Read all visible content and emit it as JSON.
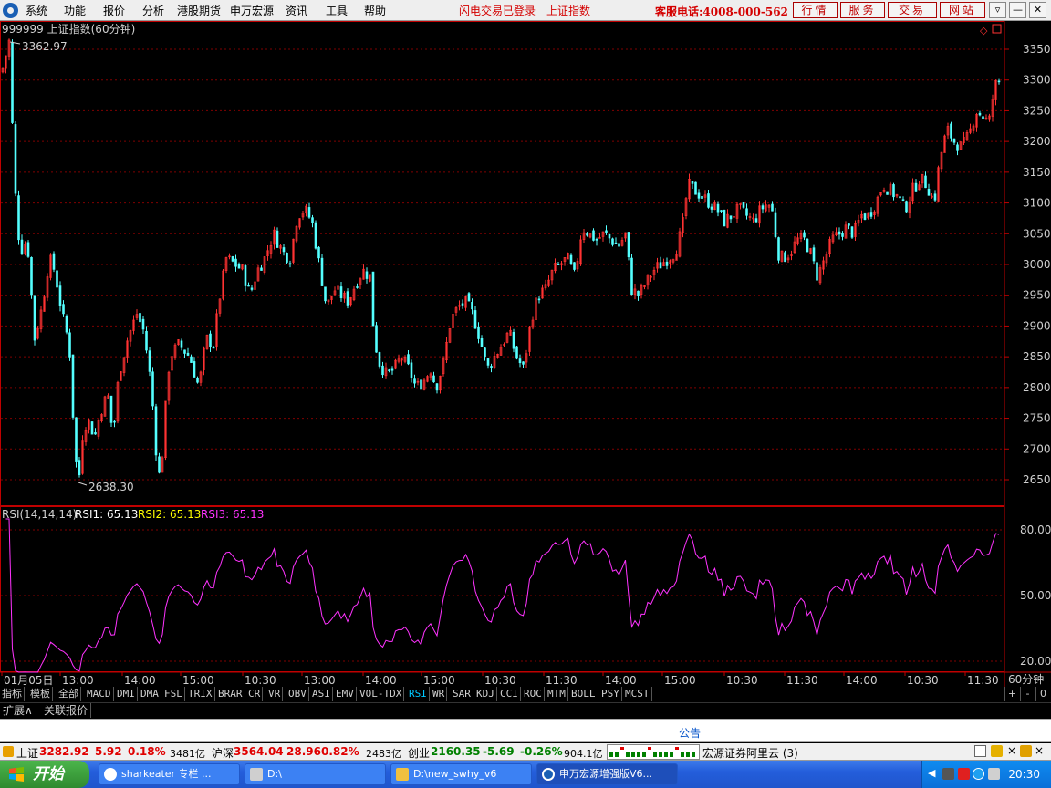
{
  "menu": {
    "items": [
      "系统",
      "功能",
      "报价",
      "分析",
      "港股期货",
      "申万宏源",
      "资讯",
      "工具",
      "帮助"
    ],
    "status_login": "闪电交易已登录",
    "status_index": "上证指数",
    "hotline": "客服电话:4008-000-562",
    "buttons": [
      "行情",
      "服务",
      "交易",
      "网站"
    ]
  },
  "chart": {
    "title": "999999 上证指数(60分钟)",
    "high_label": "3362.97",
    "low_label": "2638.30",
    "price_ticks": [
      "3350",
      "3300",
      "3250",
      "3200",
      "3150",
      "3100",
      "3050",
      "3000",
      "2950",
      "2900",
      "2850",
      "2800",
      "2750",
      "2700",
      "2650"
    ],
    "rsi_header": "RSI(14,14,14)",
    "rsi1_label": "RSI1: 65.13",
    "rsi2_label": "RSI2: 65.13",
    "rsi3_label": "RSI3: 65.13",
    "rsi_ticks": [
      "80.00",
      "50.00",
      "20.00"
    ],
    "time_labels": [
      "01月05日",
      "13:00",
      "14:00",
      "15:00",
      "10:30",
      "13:00",
      "14:00",
      "15:00",
      "10:30",
      "11:30",
      "14:00",
      "15:00",
      "10:30",
      "11:30",
      "14:00",
      "10:30",
      "11:30"
    ],
    "period_label": "60分钟",
    "colors": {
      "up": "#ff3232",
      "down": "#54ffff",
      "rsi": "#ff33ff",
      "grid": "#800000",
      "axis": "#c00000"
    }
  },
  "chart_data": {
    "type": "candlestick",
    "title": "999999 上证指数(60分钟)",
    "ylim": [
      2620,
      3380
    ],
    "max_price": 3362.97,
    "min_price": 2638.3,
    "last_close": 3282.92,
    "close_path": [
      [
        0,
        3300
      ],
      [
        10,
        3362.97
      ],
      [
        16,
        3130
      ],
      [
        22,
        3020
      ],
      [
        30,
        3040
      ],
      [
        38,
        2880
      ],
      [
        46,
        2930
      ],
      [
        54,
        3010
      ],
      [
        60,
        2990
      ],
      [
        68,
        2920
      ],
      [
        76,
        2870
      ],
      [
        82,
        2700
      ],
      [
        86,
        2638.3
      ],
      [
        90,
        2720
      ],
      [
        96,
        2750
      ],
      [
        104,
        2720
      ],
      [
        110,
        2760
      ],
      [
        118,
        2790
      ],
      [
        124,
        2720
      ],
      [
        130,
        2820
      ],
      [
        140,
        2880
      ],
      [
        150,
        2920
      ],
      [
        158,
        2890
      ],
      [
        166,
        2800
      ],
      [
        172,
        2680
      ],
      [
        176,
        2645
      ],
      [
        180,
        2740
      ],
      [
        186,
        2850
      ],
      [
        196,
        2870
      ],
      [
        208,
        2850
      ],
      [
        218,
        2800
      ],
      [
        226,
        2880
      ],
      [
        234,
        2870
      ],
      [
        240,
        2940
      ],
      [
        248,
        3010
      ],
      [
        258,
        3000
      ],
      [
        266,
        2990
      ],
      [
        274,
        2950
      ],
      [
        282,
        2990
      ],
      [
        290,
        3010
      ],
      [
        300,
        3050
      ],
      [
        310,
        3020
      ],
      [
        318,
        3010
      ],
      [
        326,
        3080
      ],
      [
        334,
        3090
      ],
      [
        342,
        3070
      ],
      [
        350,
        3000
      ],
      [
        358,
        2930
      ],
      [
        366,
        2960
      ],
      [
        374,
        2950
      ],
      [
        382,
        2940
      ],
      [
        390,
        2970
      ],
      [
        398,
        2990
      ],
      [
        406,
        2980
      ],
      [
        410,
        2880
      ],
      [
        416,
        2840
      ],
      [
        424,
        2820
      ],
      [
        432,
        2830
      ],
      [
        440,
        2850
      ],
      [
        448,
        2830
      ],
      [
        456,
        2800
      ],
      [
        464,
        2810
      ],
      [
        472,
        2830
      ],
      [
        478,
        2800
      ],
      [
        486,
        2840
      ],
      [
        494,
        2910
      ],
      [
        502,
        2930
      ],
      [
        510,
        2940
      ],
      [
        518,
        2920
      ],
      [
        526,
        2880
      ],
      [
        534,
        2830
      ],
      [
        542,
        2850
      ],
      [
        550,
        2870
      ],
      [
        558,
        2890
      ],
      [
        566,
        2850
      ],
      [
        574,
        2830
      ],
      [
        582,
        2910
      ],
      [
        590,
        2950
      ],
      [
        598,
        2960
      ],
      [
        606,
        2990
      ],
      [
        614,
        3000
      ],
      [
        622,
        3010
      ],
      [
        630,
        2980
      ],
      [
        638,
        3060
      ],
      [
        646,
        3050
      ],
      [
        654,
        3040
      ],
      [
        662,
        3050
      ],
      [
        670,
        3040
      ],
      [
        678,
        3030
      ],
      [
        686,
        3050
      ],
      [
        692,
        2960
      ],
      [
        700,
        2950
      ],
      [
        708,
        2970
      ],
      [
        716,
        2990
      ],
      [
        724,
        3000
      ],
      [
        732,
        3010
      ],
      [
        740,
        3020
      ],
      [
        748,
        3060
      ],
      [
        754,
        3130
      ],
      [
        762,
        3120
      ],
      [
        770,
        3110
      ],
      [
        778,
        3100
      ],
      [
        786,
        3090
      ],
      [
        794,
        3070
      ],
      [
        802,
        3080
      ],
      [
        810,
        3090
      ],
      [
        818,
        3080
      ],
      [
        826,
        3070
      ],
      [
        834,
        3090
      ],
      [
        842,
        3100
      ],
      [
        848,
        3080
      ],
      [
        852,
        3020
      ],
      [
        858,
        3010
      ],
      [
        866,
        3020
      ],
      [
        874,
        3040
      ],
      [
        882,
        3040
      ],
      [
        888,
        3020
      ],
      [
        896,
        2980
      ],
      [
        904,
        3010
      ],
      [
        912,
        3040
      ],
      [
        920,
        3050
      ],
      [
        928,
        3060
      ],
      [
        936,
        3050
      ],
      [
        944,
        3080
      ],
      [
        952,
        3080
      ],
      [
        960,
        3100
      ],
      [
        968,
        3130
      ],
      [
        976,
        3120
      ],
      [
        984,
        3110
      ],
      [
        992,
        3090
      ],
      [
        1000,
        3120
      ],
      [
        1008,
        3140
      ],
      [
        1016,
        3130
      ],
      [
        1024,
        3100
      ],
      [
        1030,
        3170
      ],
      [
        1038,
        3220
      ],
      [
        1046,
        3200
      ],
      [
        1054,
        3190
      ],
      [
        1062,
        3210
      ],
      [
        1070,
        3250
      ],
      [
        1078,
        3240
      ],
      [
        1084,
        3230
      ],
      [
        1090,
        3290
      ],
      [
        1096,
        3300
      ]
    ],
    "rsi1_last": 65.13,
    "rsi2_last": 65.13,
    "rsi3_last": 65.13,
    "rsi_ylim": [
      15,
      85
    ]
  },
  "indicator_tabs": [
    "指标",
    "模板",
    "全部",
    "MACD",
    "DMI",
    "DMA",
    "FSL",
    "TRIX",
    "BRAR",
    "CR",
    "VR",
    "OBV",
    "ASI",
    "EMV",
    "VOL-TDX",
    "RSI",
    "WR",
    "SAR",
    "KDJ",
    "CCI",
    "ROC",
    "MTM",
    "BOLL",
    "PSY",
    "MCST"
  ],
  "active_indicator": "RSI",
  "tab_controls": [
    "+",
    "-",
    "0"
  ],
  "sub_tabs": [
    "扩展∧",
    "关联报价"
  ],
  "notice": {
    "title": "公告"
  },
  "statusbar": {
    "sh_label": "上证",
    "sh_price": "3282.92",
    "sh_change": "5.92",
    "sh_pct": "0.18%",
    "sh_amount": "3481亿",
    "sz_label": "沪深",
    "sz_price": "3564.04",
    "sz_change": "28.96",
    "sz_pct": "0.82%",
    "sz_amount": "2483亿",
    "cy_label": "创业",
    "cy_price": "2160.35",
    "cy_change": "-5.69",
    "cy_pct": "-0.26%",
    "cy_amount": "904.1亿",
    "cloud": "宏源证券阿里云 (3)"
  },
  "taskbar": {
    "start": "开始",
    "buttons": [
      "sharkeater 专栏 ...",
      "D:\\",
      "D:\\new_swhy_v6",
      "申万宏源增强版V6..."
    ],
    "clock": "20:30"
  }
}
